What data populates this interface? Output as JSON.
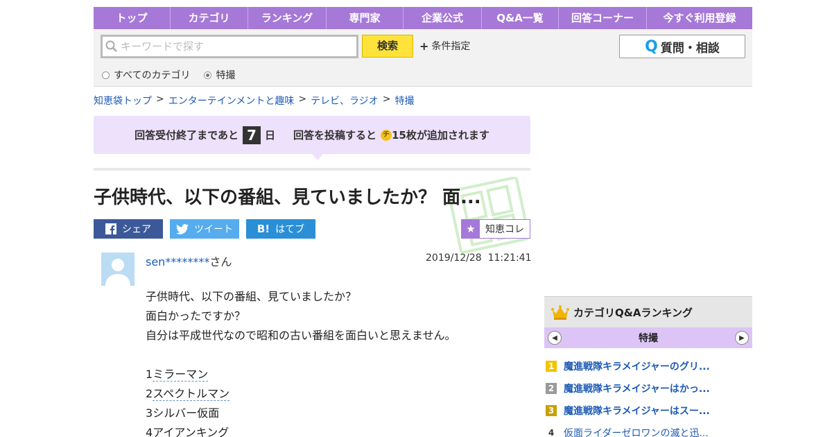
{
  "nav": {
    "items": [
      "トップ",
      "カテゴリ",
      "ランキング",
      "専門家",
      "企業公式",
      "Q&A一覧",
      "回答コーナー",
      "今すぐ利用登録"
    ]
  },
  "search": {
    "placeholder": "キーワードで探す",
    "button_label": "検索",
    "conditions_label": "条件指定",
    "ask_label": "質問・相談",
    "ask_icon_letter": "Q",
    "scope_all": "すべてのカテゴリ",
    "scope_current": "特撮"
  },
  "breadcrumb": {
    "items": [
      "知恵袋トップ",
      "エンターテインメントと趣味",
      "テレビ、ラジオ",
      "特撮"
    ],
    "separator": ">"
  },
  "notice": {
    "prefix": "回答受付終了まであと",
    "days": "7",
    "days_unit": "日",
    "middle": "回答を投稿すると",
    "coin_label": "チ",
    "suffix": "15枚が追加されます"
  },
  "question": {
    "title": "子供時代、以下の番組、見ていましたか？ 面...",
    "user_name": "sen********",
    "user_suffix": "さん",
    "date": "2019/12/28",
    "time": "11:21:41",
    "lines": [
      "子供時代、以下の番組、見ていましたか？",
      "面白かったですか？",
      "自分は平成世代なので昭和の古い番組を面白いと思えません。"
    ],
    "list": [
      {
        "num": "1",
        "text": "ミラーマン",
        "linked": true
      },
      {
        "num": "2",
        "text": "スペクトルマン",
        "linked": true
      },
      {
        "num": "3",
        "text": "シルバー仮面",
        "linked": false
      },
      {
        "num": "4",
        "text": "アイアンキング",
        "linked": false
      }
    ]
  },
  "share": {
    "facebook": "シェア",
    "twitter": "ツイート",
    "hatena": "はてブ",
    "hatena_icon": "B!",
    "chie_colle": "知恵コレ"
  },
  "ranking": {
    "title": "カテゴリQ&Aランキング",
    "tab": "特撮",
    "items": [
      {
        "rank": "1",
        "title": "魔進戦隊キラメイジャーのグリ...",
        "color": "#f2c400"
      },
      {
        "rank": "2",
        "title": "魔進戦隊キラメイジャーはかっ...",
        "color": "#9a9a9a"
      },
      {
        "rank": "3",
        "title": "魔進戦隊キラメイジャーはスー...",
        "color": "#c9a000"
      },
      {
        "rank": "4",
        "title": "仮面ライダーゼロワンの滅と迅...",
        "color": ""
      }
    ]
  },
  "colors": {
    "nav": "#a678d8",
    "link": "#1e5bb5",
    "search_button": "#ffe23a",
    "notice_bg": "#ede1fb",
    "facebook": "#3b5998",
    "twitter": "#55acee",
    "hatena": "#2a8fd6"
  }
}
